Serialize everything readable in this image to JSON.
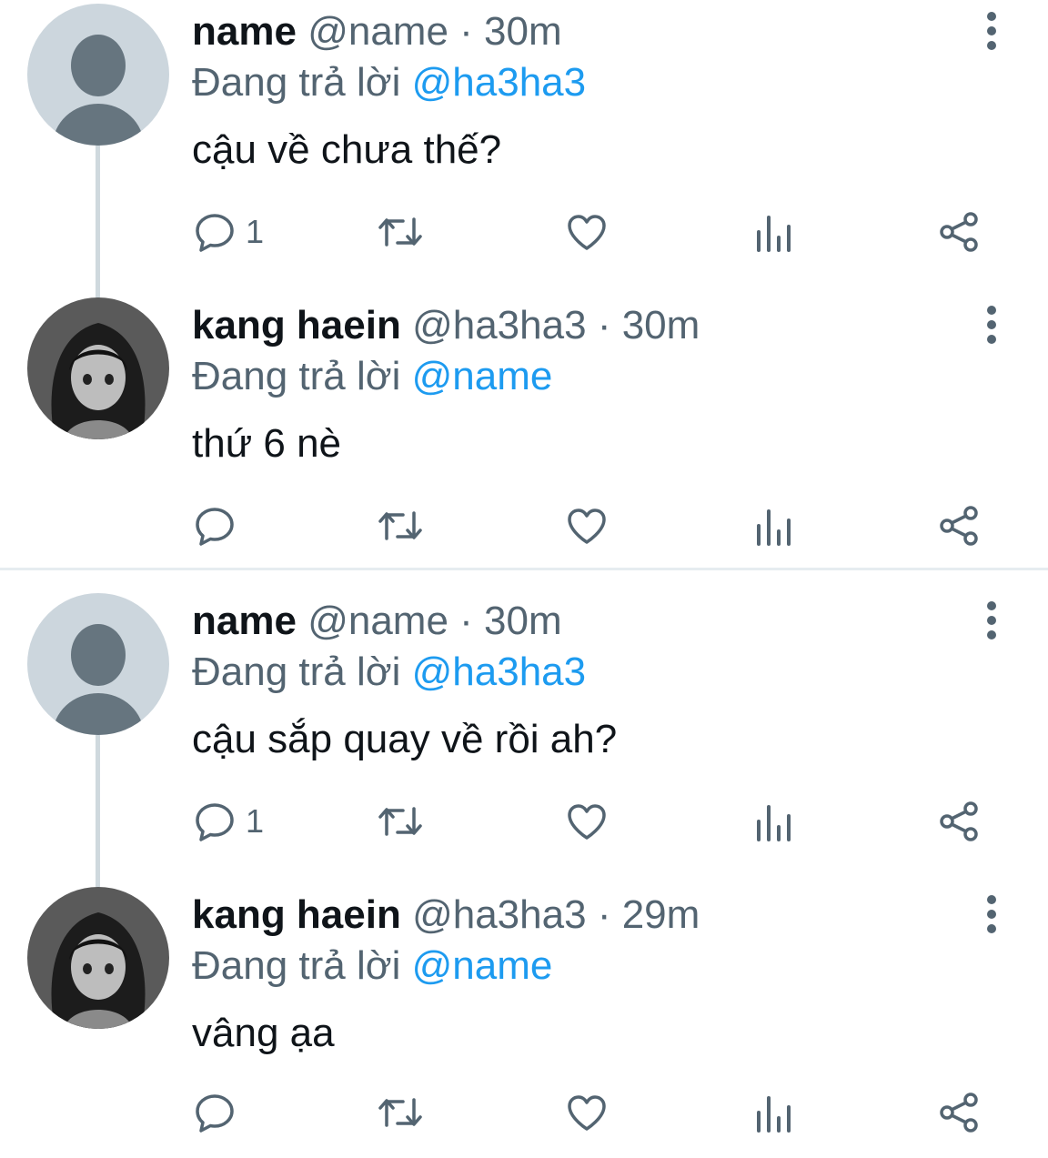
{
  "threads": [
    {
      "tweets": [
        {
          "display_name": "name",
          "handle": "@name",
          "separator": "·",
          "time": "30m",
          "reply_prefix": "Đang trả lời",
          "reply_to": "@ha3ha3",
          "text": "cậu về chưa thế?",
          "reply_count": "1",
          "avatar": "default-avatar"
        },
        {
          "display_name": "kang haein",
          "handle": "@ha3ha3",
          "separator": "·",
          "time": "30m",
          "reply_prefix": "Đang trả lời",
          "reply_to": "@name",
          "text": "thứ 6 nè",
          "reply_count": "",
          "avatar": "anime-girl-avatar"
        }
      ]
    },
    {
      "tweets": [
        {
          "display_name": "name",
          "handle": "@name",
          "separator": "·",
          "time": "30m",
          "reply_prefix": "Đang trả lời",
          "reply_to": "@ha3ha3",
          "text": "cậu sắp quay về rồi ah?",
          "reply_count": "1",
          "avatar": "default-avatar"
        },
        {
          "display_name": "kang haein",
          "handle": "@ha3ha3",
          "separator": "·",
          "time": "29m",
          "reply_prefix": "Đang trả lời",
          "reply_to": "@name",
          "text": "vâng ạa",
          "reply_count": "",
          "avatar": "anime-girl-avatar"
        }
      ]
    }
  ],
  "icons": [
    "reply-icon",
    "retweet-icon",
    "like-icon",
    "views-icon",
    "share-icon",
    "more-icon"
  ],
  "colors": {
    "text_primary": "#0f1419",
    "text_secondary": "#536471",
    "accent": "#1d9bf0",
    "thread_line": "#cfd9de",
    "default_avatar_bg": "#ccd6dd",
    "default_avatar_fg": "#66757f"
  }
}
